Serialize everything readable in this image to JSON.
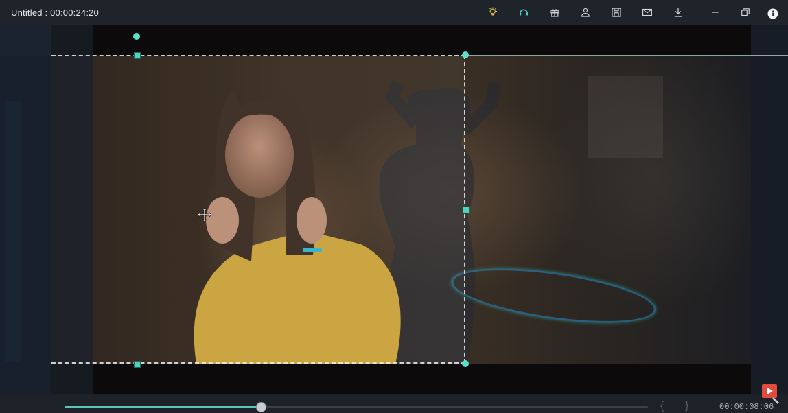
{
  "window": {
    "title": "Untitled : 00:00:24:20"
  },
  "toolbar": {
    "icons": [
      "lightbulb-icon",
      "headset-icon",
      "gift-icon",
      "account-icon",
      "save-icon",
      "mail-icon",
      "download-icon",
      "minimize-icon",
      "restore-icon",
      "info-icon"
    ]
  },
  "timeline": {
    "progress": 0.335,
    "time": "00:00:08:06",
    "mark_in": "{",
    "mark_out": "}"
  },
  "colors": {
    "accent": "#5bc6b6",
    "handle": "#4fd3bf"
  }
}
